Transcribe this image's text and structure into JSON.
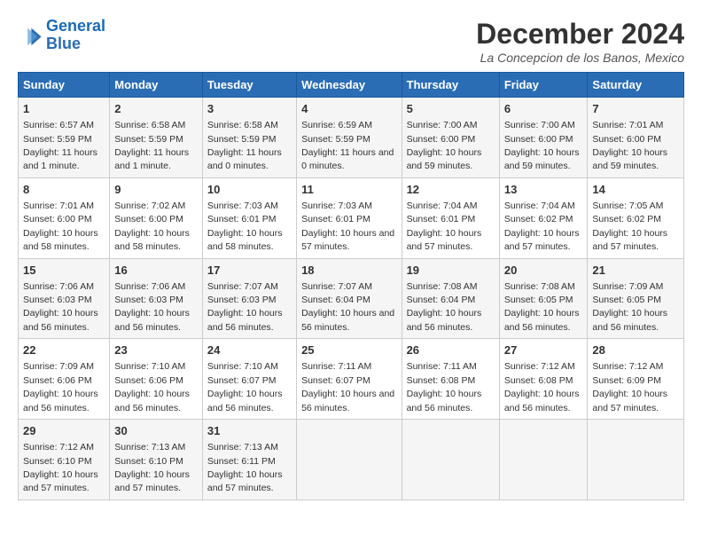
{
  "logo": {
    "line1": "General",
    "line2": "Blue"
  },
  "title": "December 2024",
  "location": "La Concepcion de los Banos, Mexico",
  "days_of_week": [
    "Sunday",
    "Monday",
    "Tuesday",
    "Wednesday",
    "Thursday",
    "Friday",
    "Saturday"
  ],
  "weeks": [
    [
      {
        "day": "1",
        "sunrise": "6:57 AM",
        "sunset": "5:59 PM",
        "daylight": "11 hours and 1 minute."
      },
      {
        "day": "2",
        "sunrise": "6:58 AM",
        "sunset": "5:59 PM",
        "daylight": "11 hours and 1 minute."
      },
      {
        "day": "3",
        "sunrise": "6:58 AM",
        "sunset": "5:59 PM",
        "daylight": "11 hours and 0 minutes."
      },
      {
        "day": "4",
        "sunrise": "6:59 AM",
        "sunset": "5:59 PM",
        "daylight": "11 hours and 0 minutes."
      },
      {
        "day": "5",
        "sunrise": "7:00 AM",
        "sunset": "6:00 PM",
        "daylight": "10 hours and 59 minutes."
      },
      {
        "day": "6",
        "sunrise": "7:00 AM",
        "sunset": "6:00 PM",
        "daylight": "10 hours and 59 minutes."
      },
      {
        "day": "7",
        "sunrise": "7:01 AM",
        "sunset": "6:00 PM",
        "daylight": "10 hours and 59 minutes."
      }
    ],
    [
      {
        "day": "8",
        "sunrise": "7:01 AM",
        "sunset": "6:00 PM",
        "daylight": "10 hours and 58 minutes."
      },
      {
        "day": "9",
        "sunrise": "7:02 AM",
        "sunset": "6:00 PM",
        "daylight": "10 hours and 58 minutes."
      },
      {
        "day": "10",
        "sunrise": "7:03 AM",
        "sunset": "6:01 PM",
        "daylight": "10 hours and 58 minutes."
      },
      {
        "day": "11",
        "sunrise": "7:03 AM",
        "sunset": "6:01 PM",
        "daylight": "10 hours and 57 minutes."
      },
      {
        "day": "12",
        "sunrise": "7:04 AM",
        "sunset": "6:01 PM",
        "daylight": "10 hours and 57 minutes."
      },
      {
        "day": "13",
        "sunrise": "7:04 AM",
        "sunset": "6:02 PM",
        "daylight": "10 hours and 57 minutes."
      },
      {
        "day": "14",
        "sunrise": "7:05 AM",
        "sunset": "6:02 PM",
        "daylight": "10 hours and 57 minutes."
      }
    ],
    [
      {
        "day": "15",
        "sunrise": "7:06 AM",
        "sunset": "6:03 PM",
        "daylight": "10 hours and 56 minutes."
      },
      {
        "day": "16",
        "sunrise": "7:06 AM",
        "sunset": "6:03 PM",
        "daylight": "10 hours and 56 minutes."
      },
      {
        "day": "17",
        "sunrise": "7:07 AM",
        "sunset": "6:03 PM",
        "daylight": "10 hours and 56 minutes."
      },
      {
        "day": "18",
        "sunrise": "7:07 AM",
        "sunset": "6:04 PM",
        "daylight": "10 hours and 56 minutes."
      },
      {
        "day": "19",
        "sunrise": "7:08 AM",
        "sunset": "6:04 PM",
        "daylight": "10 hours and 56 minutes."
      },
      {
        "day": "20",
        "sunrise": "7:08 AM",
        "sunset": "6:05 PM",
        "daylight": "10 hours and 56 minutes."
      },
      {
        "day": "21",
        "sunrise": "7:09 AM",
        "sunset": "6:05 PM",
        "daylight": "10 hours and 56 minutes."
      }
    ],
    [
      {
        "day": "22",
        "sunrise": "7:09 AM",
        "sunset": "6:06 PM",
        "daylight": "10 hours and 56 minutes."
      },
      {
        "day": "23",
        "sunrise": "7:10 AM",
        "sunset": "6:06 PM",
        "daylight": "10 hours and 56 minutes."
      },
      {
        "day": "24",
        "sunrise": "7:10 AM",
        "sunset": "6:07 PM",
        "daylight": "10 hours and 56 minutes."
      },
      {
        "day": "25",
        "sunrise": "7:11 AM",
        "sunset": "6:07 PM",
        "daylight": "10 hours and 56 minutes."
      },
      {
        "day": "26",
        "sunrise": "7:11 AM",
        "sunset": "6:08 PM",
        "daylight": "10 hours and 56 minutes."
      },
      {
        "day": "27",
        "sunrise": "7:12 AM",
        "sunset": "6:08 PM",
        "daylight": "10 hours and 56 minutes."
      },
      {
        "day": "28",
        "sunrise": "7:12 AM",
        "sunset": "6:09 PM",
        "daylight": "10 hours and 57 minutes."
      }
    ],
    [
      {
        "day": "29",
        "sunrise": "7:12 AM",
        "sunset": "6:10 PM",
        "daylight": "10 hours and 57 minutes."
      },
      {
        "day": "30",
        "sunrise": "7:13 AM",
        "sunset": "6:10 PM",
        "daylight": "10 hours and 57 minutes."
      },
      {
        "day": "31",
        "sunrise": "7:13 AM",
        "sunset": "6:11 PM",
        "daylight": "10 hours and 57 minutes."
      },
      null,
      null,
      null,
      null
    ]
  ]
}
